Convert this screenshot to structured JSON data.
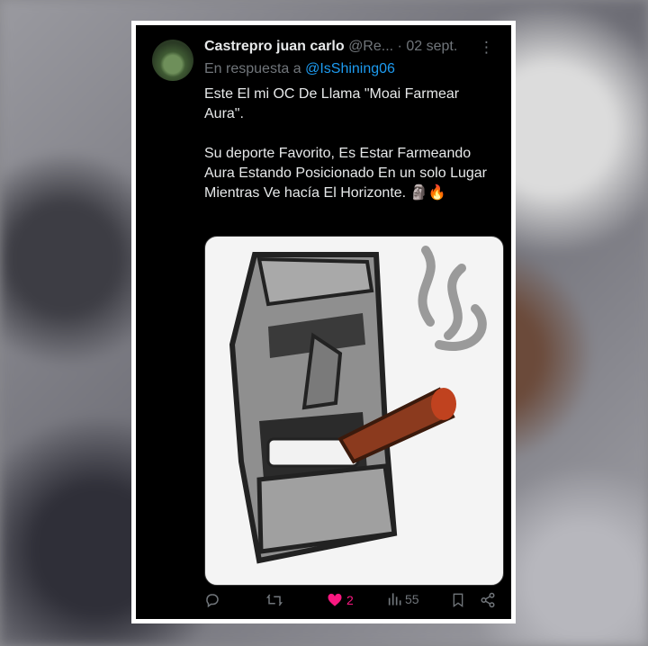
{
  "tweet": {
    "author_name": "Castrepro juan carlo",
    "author_handle": "@Re...",
    "separator": "·",
    "date": "02 sept.",
    "more": "⋮",
    "reply_prefix": "En respuesta a",
    "reply_to": "@IsShining06",
    "paragraph_1": "Este El mi OC De Llama \"Moai Farmear Aura\".",
    "paragraph_2": "Su deporte Favorito, Es Estar Farmeando Aura Estando Posicionado En un solo Lugar Mientras Ve hacía El Horizonte. 🗿🔥"
  },
  "actions": {
    "replies": "",
    "retweets": "",
    "likes": "2",
    "views": "55"
  },
  "icons": {
    "reply": "reply-icon",
    "retweet": "retweet-icon",
    "like": "heart-icon",
    "views": "views-icon",
    "bookmark": "bookmark-icon",
    "share": "share-icon"
  },
  "colors": {
    "background": "#000000",
    "text": "#e7e9ea",
    "muted": "#71767b",
    "link": "#1d9bf0",
    "like": "#f91880"
  }
}
